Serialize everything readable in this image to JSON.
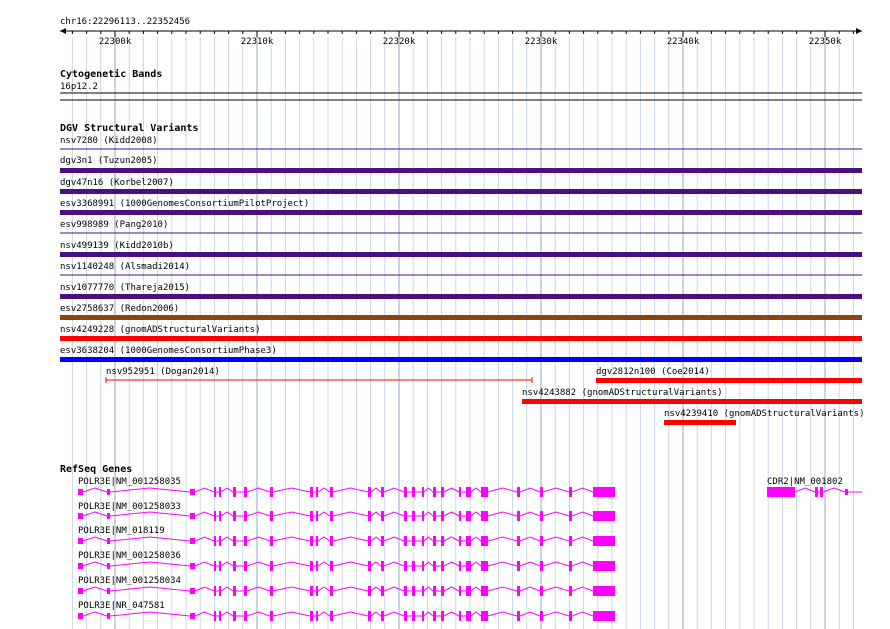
{
  "ruler": {
    "label": "chr16:22296113..22352456",
    "ticks": [
      "22300k",
      "22310k",
      "22320k",
      "22330k",
      "22340k",
      "22350k"
    ]
  },
  "cytoband": {
    "title": "Cytogenetic Bands",
    "band": "16p12.2"
  },
  "dgv": {
    "title": "DGV Structural Variants",
    "colors": {
      "purple": "#4b0f82",
      "brown": "#8b4513",
      "red": "#ff0000",
      "blue": "#0000ff"
    },
    "rows": [
      {
        "label": "nsv7280 (Kidd2008)",
        "color": "purple"
      },
      {
        "label": "dgv3n1 (Tuzun2005)",
        "color": "purple"
      },
      {
        "label": "dgv47n16 (Korbel2007)",
        "color": "purple"
      },
      {
        "label": "esv3368991 (1000GenomesConsortiumPilotProject)",
        "color": "purple"
      },
      {
        "label": "esv998989 (Pang2010)",
        "color": "purple"
      },
      {
        "label": "nsv499139 (Kidd2010b)",
        "color": "purple"
      },
      {
        "label": "nsv1140248 (Alsmadi2014)",
        "color": "purple"
      },
      {
        "label": "nsv1077770 (Thareja2015)",
        "color": "purple"
      },
      {
        "label": "esv2758637 (Redon2006)",
        "color": "brown"
      },
      {
        "label": "nsv4249228 (gnomADStructuralVariants)",
        "color": "red"
      },
      {
        "label": "esv3638204 (1000GenomesConsortiumPhase3)",
        "color": "blue"
      }
    ],
    "partial": [
      {
        "label": "nsv952951 (Dogan2014)"
      },
      {
        "label": "dgv2812n100 (Coe2014)"
      },
      {
        "label": "nsv4243882 (gnomADStructuralVariants)"
      },
      {
        "label": "nsv4239410 (gnomADStructuralVariants)"
      }
    ]
  },
  "refseq": {
    "title": "RefSeq Genes",
    "color": "#ff00ff",
    "transcripts": [
      "POLR3E|NM_001258035",
      "POLR3E|NM_001258033",
      "POLR3E|NM_018119",
      "POLR3E|NM_001258036",
      "POLR3E|NM_001258034",
      "POLR3E|NR_047581"
    ],
    "cdr2": "CDR2|NM_001802"
  }
}
